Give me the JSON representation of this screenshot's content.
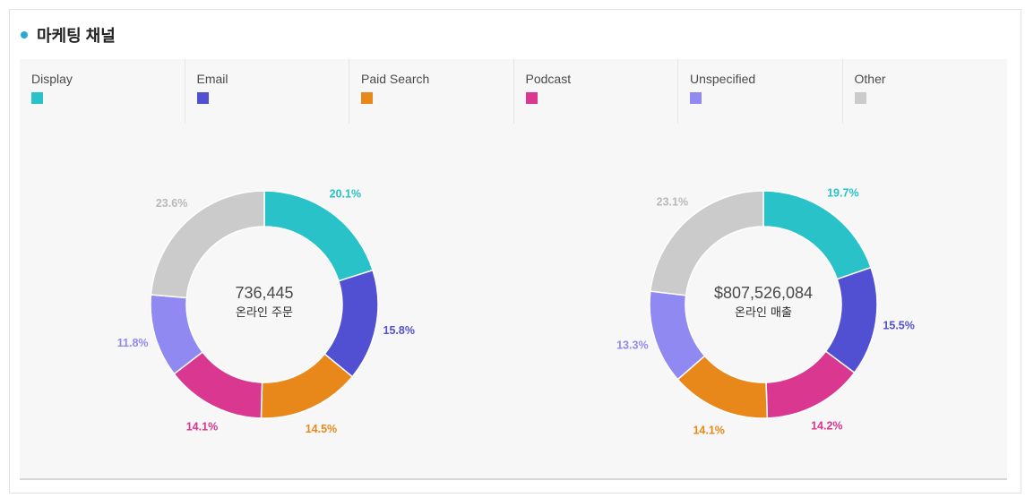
{
  "header": {
    "title": "마케팅 채널"
  },
  "legend": [
    {
      "label": "Display",
      "color": "#28c2c8"
    },
    {
      "label": "Email",
      "color": "#5150d2"
    },
    {
      "label": "Paid Search",
      "color": "#e8881b"
    },
    {
      "label": "Podcast",
      "color": "#d93790"
    },
    {
      "label": "Unspecified",
      "color": "#9089f2"
    },
    {
      "label": "Other",
      "color": "#cbcbcb"
    }
  ],
  "chart_data": [
    {
      "type": "pie",
      "donut": true,
      "center_value": "736,445",
      "center_label": "온라인 주문",
      "categories": [
        "Display",
        "Email",
        "Paid Search",
        "Podcast",
        "Unspecified",
        "Other"
      ],
      "values": [
        20.1,
        15.8,
        14.5,
        14.1,
        11.8,
        23.6
      ],
      "value_labels": [
        "20.1%",
        "15.8%",
        "14.5%",
        "14.1%",
        "11.8%",
        "23.6%"
      ]
    },
    {
      "type": "pie",
      "donut": true,
      "center_value": "$807,526,084",
      "center_label": "온라인 매출",
      "categories": [
        "Display",
        "Email",
        "Podcast",
        "Paid Search",
        "Unspecified",
        "Other"
      ],
      "values": [
        19.7,
        15.5,
        14.2,
        14.1,
        13.3,
        23.1
      ],
      "value_labels": [
        "19.7%",
        "15.5%",
        "14.2%",
        "14.1%",
        "13.3%",
        "23.1%"
      ]
    }
  ]
}
